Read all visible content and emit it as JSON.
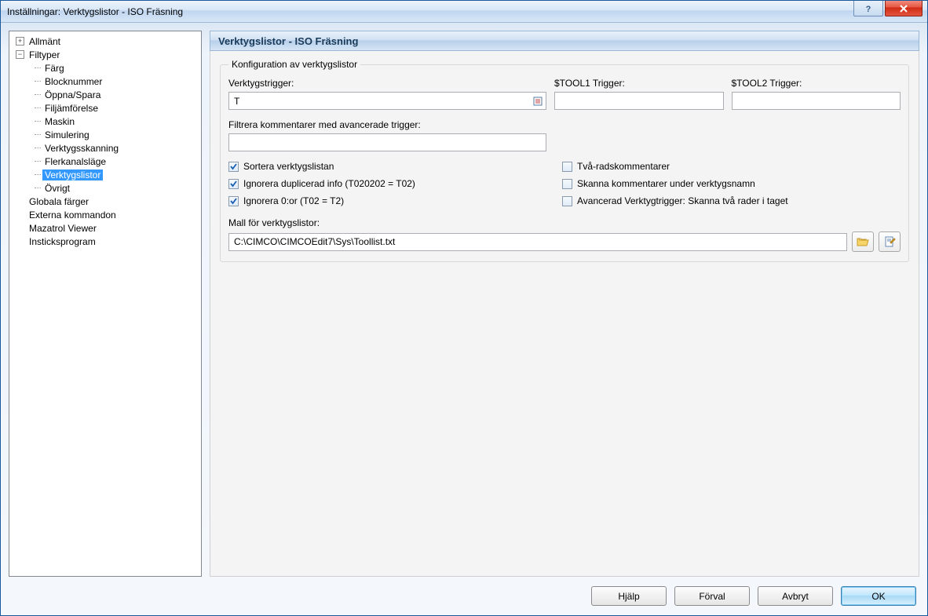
{
  "window": {
    "title": "Inställningar: Verktygslistor - ISO Fräsning"
  },
  "tree": {
    "allmant": "Allmänt",
    "filtyper": "Filtyper",
    "children": {
      "farg": "Färg",
      "blocknummer": "Blocknummer",
      "oppna_spara": "Öppna/Spara",
      "filjamforelse": "Filjämförelse",
      "maskin": "Maskin",
      "simulering": "Simulering",
      "verktygsskanning": "Verktygsskanning",
      "flerkanalslage": "Flerkanalsläge",
      "verktygslistor": "Verktygslistor",
      "ovrigt": "Övrigt"
    },
    "globala_farger": "Globala färger",
    "externa_kommandon": "Externa kommandon",
    "mazatrol_viewer": "Mazatrol Viewer",
    "insticksprogram": "Insticksprogram"
  },
  "panel": {
    "header": "Verktygslistor - ISO Fräsning",
    "group_legend": "Konfiguration av verktygslistor",
    "labels": {
      "verktygstrigger": "Verktygstrigger:",
      "tool1": "$TOOL1 Trigger:",
      "tool2": "$TOOL2 Trigger:",
      "filter": "Filtrera kommentarer med avancerade trigger:",
      "template": "Mall för verktygslistor:"
    },
    "values": {
      "verktygstrigger": "T",
      "tool1": "",
      "tool2": "",
      "filter": "",
      "template_path": "C:\\CIMCO\\CIMCOEdit7\\Sys\\Toollist.txt"
    },
    "checks": {
      "left": [
        {
          "label": "Sortera verktygslistan",
          "checked": true
        },
        {
          "label": "Ignorera duplicerad info (T020202 = T02)",
          "checked": true
        },
        {
          "label": "Ignorera 0:or (T02 = T2)",
          "checked": true
        }
      ],
      "right": [
        {
          "label": "Två-radskommentarer",
          "checked": false
        },
        {
          "label": "Skanna kommentarer under verktygsnamn",
          "checked": false
        },
        {
          "label": "Avancerad Verktygtrigger: Skanna två rader i taget",
          "checked": false
        }
      ]
    }
  },
  "buttons": {
    "help": "Hjälp",
    "default": "Förval",
    "cancel": "Avbryt",
    "ok": "OK"
  }
}
